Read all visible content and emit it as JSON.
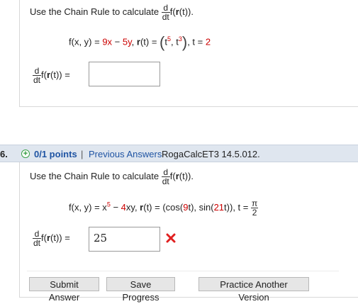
{
  "prev_question": {
    "prompt_text": "Use the Chain Rule to calculate",
    "d": "d",
    "dt": "dt",
    "prompt_f": "f(",
    "prompt_r": "r",
    "prompt_tail": "(t)).",
    "func_pre": "f(x, y) = ",
    "func_a": "9x",
    "func_mid": " − ",
    "func_b": "5y",
    "func_sep": ", ",
    "r_label": "r",
    "r_eq": "(t) = ",
    "paren_open": "(",
    "t1": "t",
    "exp1": "5",
    "comma": ", ",
    "t2": "t",
    "exp2": "3",
    "paren_close": ")",
    "t_eq": ", t = ",
    "t_val": "2",
    "answer_label_f": "f(",
    "answer_label_r": "r",
    "answer_label_tail": "(t)) =",
    "answer_value": ""
  },
  "question": {
    "number": "6.",
    "points": "0/1 points",
    "separator": "|",
    "previous_answers": "Previous Answers",
    "source": "RogaCalcET3 14.5.012.",
    "prompt_text": "Use the Chain Rule to calculate",
    "d": "d",
    "dt": "dt",
    "prompt_f": "f(",
    "prompt_r": "r",
    "prompt_tail": "(t)).",
    "func_pre": "f(x, y) = x",
    "func_exp": "5",
    "func_mid": " − ",
    "func_coef": "4",
    "func_xy": "xy",
    "func_sep": ", ",
    "r_label": "r",
    "r_eq": "(t) = (cos(",
    "cos_coef": "9",
    "cos_tail": "t), sin(",
    "sin_coef": "21",
    "sin_tail": "t)), t = ",
    "pi": "π",
    "two": "2",
    "answer_label_f": "f(",
    "answer_label_r": "r",
    "answer_label_tail": "(t)) =",
    "answer_value": "25",
    "status_icon": "x-mark-icon"
  },
  "buttons": {
    "submit": "Submit Answer",
    "save": "Save Progress",
    "practice": "Practice Another Version"
  },
  "colors": {
    "accent_red": "#cc0000",
    "link_blue": "#1f54a3",
    "header_bg": "#dfe6ef",
    "plus_green": "#2c9a3a"
  }
}
